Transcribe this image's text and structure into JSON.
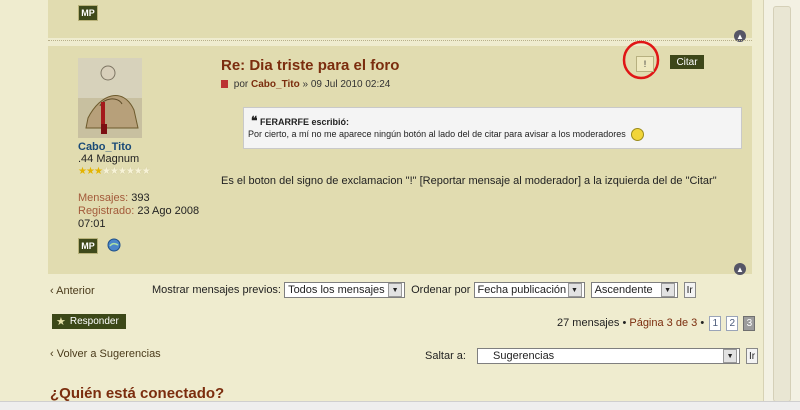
{
  "post": {
    "title": "Re: Dia triste para el foro",
    "byline_prefix": "por",
    "author": "Cabo_Tito",
    "date": "» 09 Jul 2010 02:24",
    "report_label": "!",
    "quote_button": "Citar",
    "quote": {
      "author": "FERARRFE escribió:",
      "text": "Por cierto, a mí no me aparece ningún botón al lado del de citar para avisar a los moderadores"
    },
    "body": "Es el boton del signo de exclamacion \"!\" [Reportar mensaje al moderador] a la izquierda del de \"Citar\""
  },
  "profile": {
    "username": "Cabo_Tito",
    "rank": ".44 Magnum",
    "stars_filled": 3,
    "stars_total": 9,
    "messages_label": "Mensajes:",
    "messages_value": "393",
    "registered_label": "Registrado:",
    "registered_value": "23 Ago 2008",
    "registered_time": "07:01",
    "mp_label": "MP"
  },
  "top_post": {
    "mp_label": "MP"
  },
  "nav": {
    "previous": "Anterior",
    "show_previous_label": "Mostrar mensajes previos:",
    "show_previous_value": "Todos los mensajes",
    "order_by_label": "Ordenar por",
    "order_by_value": "Fecha publicación",
    "direction_value": "Ascendente",
    "go_label": "Ir"
  },
  "actions": {
    "reply": "Responder"
  },
  "pagination": {
    "summary": "27 mensajes",
    "page_info": "Página 3 de 3",
    "pages": [
      "1",
      "2",
      "3"
    ]
  },
  "footer_nav": {
    "back": "Volver a Sugerencias",
    "jump_label": "Saltar a:",
    "jump_value": "Sugerencias",
    "go_label": "Ir"
  },
  "online": {
    "heading": "¿Quién está conectado?"
  }
}
